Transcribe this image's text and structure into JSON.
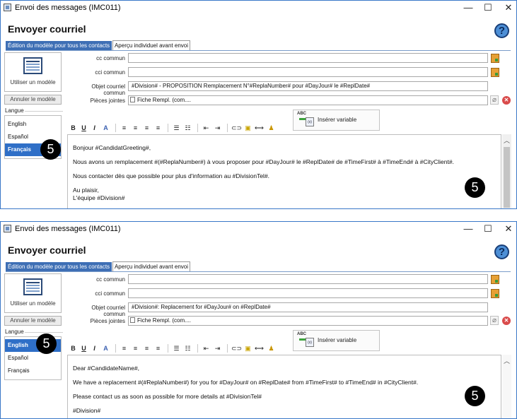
{
  "colors": {
    "accent": "#3e6fb5",
    "selected": "#2f6fc7",
    "window_border": "#3a78c8",
    "badge": "#000000"
  },
  "icons": {
    "minimize": "minimize-icon",
    "maximize": "maximize-icon",
    "close": "close-icon",
    "help": "help-icon",
    "address_book": "address-book-icon",
    "attachment": "paperclip-icon",
    "delete": "delete-icon"
  },
  "window_title": "Envoi des messages (IMC011)",
  "window_controls": {
    "minimize": "—",
    "maximize": "☐",
    "close": "✕"
  },
  "heading": "Envoyer courriel",
  "help_symbol": "?",
  "tabs": [
    "Édition du modèle pour tous les contacts",
    "Aperçu individuel avant envoi"
  ],
  "template_button_label": "Utiliser un modèle",
  "annul_button_label": "Annuler le modèle",
  "langue_label": "Langue",
  "languages": [
    "English",
    "Español",
    "Français"
  ],
  "field_labels": {
    "cc": "cc commun",
    "cci": "cci commun",
    "subject": "Objet courriel commun",
    "attachments": "Pièces jointes"
  },
  "attachment_chip": "Fiche Rempl. (com....",
  "insert_variable_label": "Insérer variable",
  "insert_variable_icon": {
    "abc": "ABC",
    "var": "(x)"
  },
  "toolbar": {
    "bold": "B",
    "underline": "U",
    "italic": "I",
    "color": "A",
    "line": "⟷",
    "stamp": "♟"
  },
  "badge_number": "5",
  "panels": [
    {
      "selected_language": "Français",
      "subject": "#Division# - PROPOSITION Remplacement N°#ReplaNumber# pour #DayJour# le #ReplDate#",
      "body": [
        "Bonjour #CandidatGreeting#,",
        "Nous avons un remplacement #(#ReplaNumber#) à vous proposer pour #DayJour# le  #ReplDate# de #TimeFirst# à #TimeEnd# à #CityClient#.",
        "Nous contacter dès que possible pour plus d'information au #DivisionTel#.",
        "Au plaisir,",
        "L'équipe #Division#"
      ]
    },
    {
      "selected_language": "English",
      "subject": "#Division#: Replacement for #DayJour# on #ReplDate#",
      "body": [
        "Dear #CandidateName#,",
        "We have a replacement #(#ReplaNumber#) for you for #DayJour# on #ReplDate# from #TimeFirst# to #TimeEnd# in #CityClient#.",
        "Please contact us as soon as possible for more details at #DivisionTel#",
        "#Division#"
      ]
    }
  ]
}
